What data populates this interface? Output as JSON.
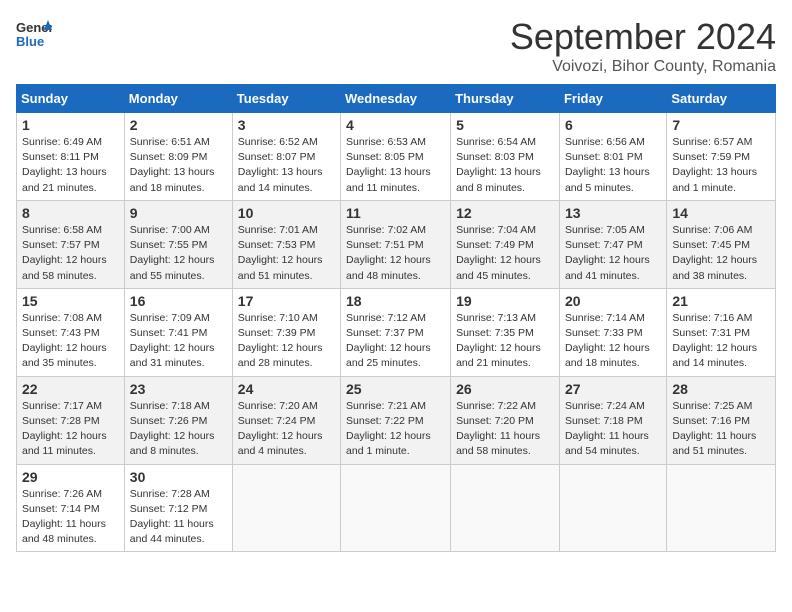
{
  "header": {
    "logo_line1": "General",
    "logo_line2": "Blue",
    "main_title": "September 2024",
    "subtitle": "Voivozi, Bihor County, Romania"
  },
  "days_of_week": [
    "Sunday",
    "Monday",
    "Tuesday",
    "Wednesday",
    "Thursday",
    "Friday",
    "Saturday"
  ],
  "weeks": [
    [
      {
        "day": "1",
        "detail": "Sunrise: 6:49 AM\nSunset: 8:11 PM\nDaylight: 13 hours\nand 21 minutes."
      },
      {
        "day": "2",
        "detail": "Sunrise: 6:51 AM\nSunset: 8:09 PM\nDaylight: 13 hours\nand 18 minutes."
      },
      {
        "day": "3",
        "detail": "Sunrise: 6:52 AM\nSunset: 8:07 PM\nDaylight: 13 hours\nand 14 minutes."
      },
      {
        "day": "4",
        "detail": "Sunrise: 6:53 AM\nSunset: 8:05 PM\nDaylight: 13 hours\nand 11 minutes."
      },
      {
        "day": "5",
        "detail": "Sunrise: 6:54 AM\nSunset: 8:03 PM\nDaylight: 13 hours\nand 8 minutes."
      },
      {
        "day": "6",
        "detail": "Sunrise: 6:56 AM\nSunset: 8:01 PM\nDaylight: 13 hours\nand 5 minutes."
      },
      {
        "day": "7",
        "detail": "Sunrise: 6:57 AM\nSunset: 7:59 PM\nDaylight: 13 hours\nand 1 minute."
      }
    ],
    [
      {
        "day": "8",
        "detail": "Sunrise: 6:58 AM\nSunset: 7:57 PM\nDaylight: 12 hours\nand 58 minutes."
      },
      {
        "day": "9",
        "detail": "Sunrise: 7:00 AM\nSunset: 7:55 PM\nDaylight: 12 hours\nand 55 minutes."
      },
      {
        "day": "10",
        "detail": "Sunrise: 7:01 AM\nSunset: 7:53 PM\nDaylight: 12 hours\nand 51 minutes."
      },
      {
        "day": "11",
        "detail": "Sunrise: 7:02 AM\nSunset: 7:51 PM\nDaylight: 12 hours\nand 48 minutes."
      },
      {
        "day": "12",
        "detail": "Sunrise: 7:04 AM\nSunset: 7:49 PM\nDaylight: 12 hours\nand 45 minutes."
      },
      {
        "day": "13",
        "detail": "Sunrise: 7:05 AM\nSunset: 7:47 PM\nDaylight: 12 hours\nand 41 minutes."
      },
      {
        "day": "14",
        "detail": "Sunrise: 7:06 AM\nSunset: 7:45 PM\nDaylight: 12 hours\nand 38 minutes."
      }
    ],
    [
      {
        "day": "15",
        "detail": "Sunrise: 7:08 AM\nSunset: 7:43 PM\nDaylight: 12 hours\nand 35 minutes."
      },
      {
        "day": "16",
        "detail": "Sunrise: 7:09 AM\nSunset: 7:41 PM\nDaylight: 12 hours\nand 31 minutes."
      },
      {
        "day": "17",
        "detail": "Sunrise: 7:10 AM\nSunset: 7:39 PM\nDaylight: 12 hours\nand 28 minutes."
      },
      {
        "day": "18",
        "detail": "Sunrise: 7:12 AM\nSunset: 7:37 PM\nDaylight: 12 hours\nand 25 minutes."
      },
      {
        "day": "19",
        "detail": "Sunrise: 7:13 AM\nSunset: 7:35 PM\nDaylight: 12 hours\nand 21 minutes."
      },
      {
        "day": "20",
        "detail": "Sunrise: 7:14 AM\nSunset: 7:33 PM\nDaylight: 12 hours\nand 18 minutes."
      },
      {
        "day": "21",
        "detail": "Sunrise: 7:16 AM\nSunset: 7:31 PM\nDaylight: 12 hours\nand 14 minutes."
      }
    ],
    [
      {
        "day": "22",
        "detail": "Sunrise: 7:17 AM\nSunset: 7:28 PM\nDaylight: 12 hours\nand 11 minutes."
      },
      {
        "day": "23",
        "detail": "Sunrise: 7:18 AM\nSunset: 7:26 PM\nDaylight: 12 hours\nand 8 minutes."
      },
      {
        "day": "24",
        "detail": "Sunrise: 7:20 AM\nSunset: 7:24 PM\nDaylight: 12 hours\nand 4 minutes."
      },
      {
        "day": "25",
        "detail": "Sunrise: 7:21 AM\nSunset: 7:22 PM\nDaylight: 12 hours\nand 1 minute."
      },
      {
        "day": "26",
        "detail": "Sunrise: 7:22 AM\nSunset: 7:20 PM\nDaylight: 11 hours\nand 58 minutes."
      },
      {
        "day": "27",
        "detail": "Sunrise: 7:24 AM\nSunset: 7:18 PM\nDaylight: 11 hours\nand 54 minutes."
      },
      {
        "day": "28",
        "detail": "Sunrise: 7:25 AM\nSunset: 7:16 PM\nDaylight: 11 hours\nand 51 minutes."
      }
    ],
    [
      {
        "day": "29",
        "detail": "Sunrise: 7:26 AM\nSunset: 7:14 PM\nDaylight: 11 hours\nand 48 minutes."
      },
      {
        "day": "30",
        "detail": "Sunrise: 7:28 AM\nSunset: 7:12 PM\nDaylight: 11 hours\nand 44 minutes."
      },
      {
        "day": "",
        "detail": ""
      },
      {
        "day": "",
        "detail": ""
      },
      {
        "day": "",
        "detail": ""
      },
      {
        "day": "",
        "detail": ""
      },
      {
        "day": "",
        "detail": ""
      }
    ]
  ]
}
